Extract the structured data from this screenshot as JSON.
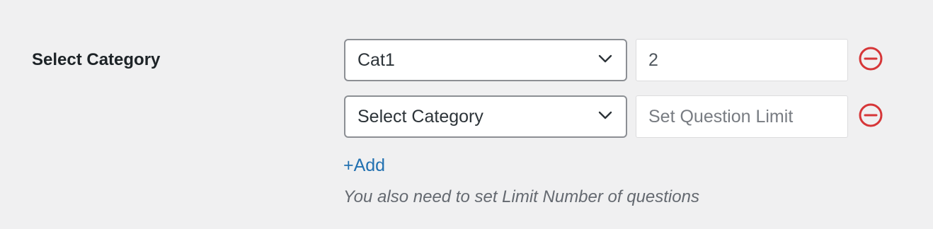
{
  "field": {
    "label": "Select Category"
  },
  "category_rows": [
    {
      "selected": "Cat1",
      "limit_value": "2",
      "limit_placeholder": "Set Question Limit"
    },
    {
      "selected": "Select Category",
      "limit_value": "",
      "limit_placeholder": "Set Question Limit"
    }
  ],
  "add_label": "+Add",
  "hint": "You also need to set Limit Number of questions",
  "icons": {
    "dropdown": "chevron-down-icon",
    "remove": "minus-circle-icon"
  },
  "colors": {
    "background": "#f0f0f1",
    "link": "#2271b1",
    "remove": "#d63638",
    "hint": "#646970"
  }
}
